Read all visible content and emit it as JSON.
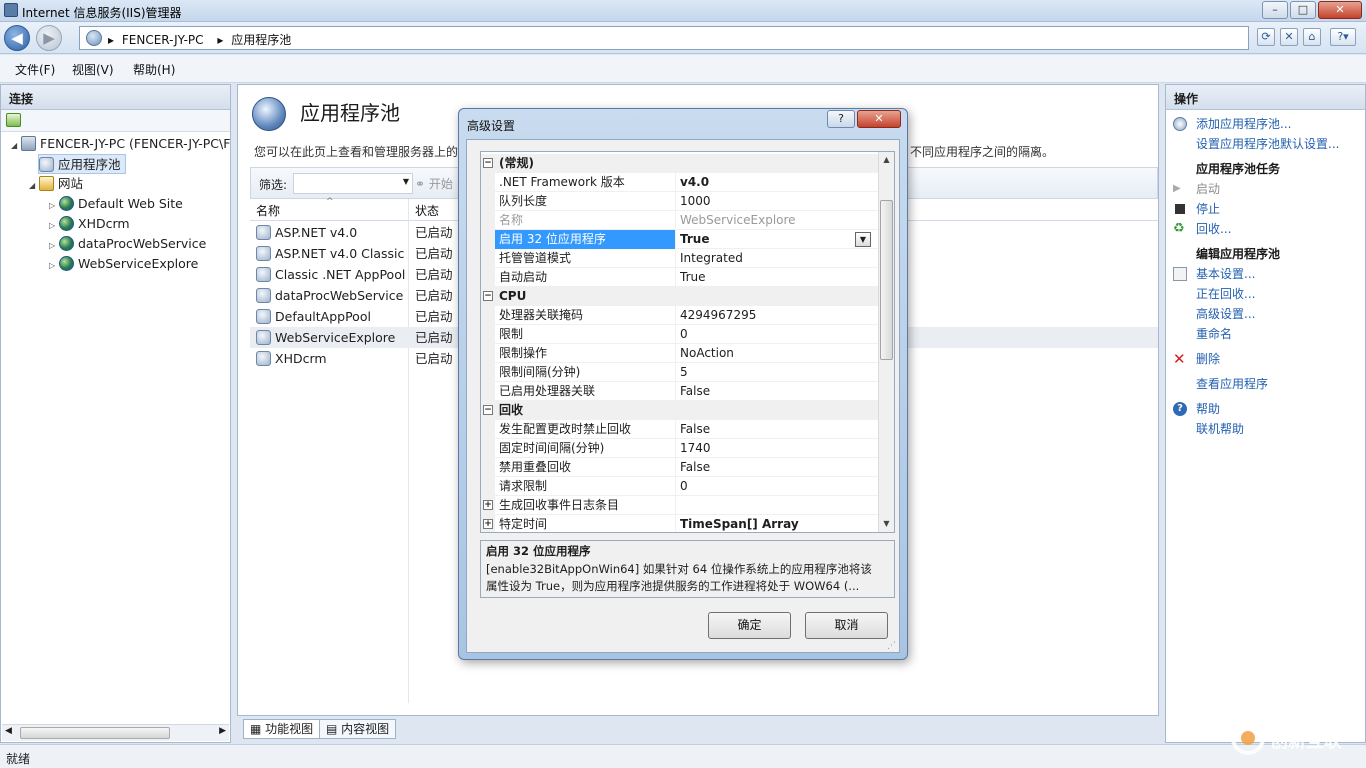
{
  "window": {
    "title": "Internet 信息服务(IIS)管理器",
    "controls": [
      "–",
      "□",
      "✕"
    ]
  },
  "address": {
    "server": "FENCER-JY-PC",
    "page": "应用程序池",
    "separator": "▸"
  },
  "menu": {
    "file": "文件(F)",
    "view": "视图(V)",
    "help": "帮助(H)"
  },
  "connections": {
    "header": "连接",
    "tree": [
      {
        "label": "FENCER-JY-PC (FENCER-JY-PC\\F"
      },
      {
        "label": "应用程序池"
      },
      {
        "label": "网站"
      },
      {
        "label": "Default Web Site"
      },
      {
        "label": "XHDcrm"
      },
      {
        "label": "dataProcWebService"
      },
      {
        "label": "WebServiceExplore"
      }
    ]
  },
  "center": {
    "heading": "应用程序池",
    "description": "您可以在此页上查看和管理服务器上的",
    "description_tail": "不同应用程序之间的隔离。",
    "filter_label": "筛选:",
    "start_button": "开始",
    "columns": {
      "name": "名称",
      "status": "状态"
    },
    "rows": [
      {
        "name": "ASP.NET v4.0",
        "status": "已启动"
      },
      {
        "name": "ASP.NET v4.0 Classic",
        "status": "已启动"
      },
      {
        "name": "Classic .NET AppPool",
        "status": "已启动"
      },
      {
        "name": "dataProcWebService",
        "status": "已启动"
      },
      {
        "name": "DefaultAppPool",
        "status": "已启动"
      },
      {
        "name": "WebServiceExplore",
        "status": "已启动"
      },
      {
        "name": "XHDcrm",
        "status": "已启动"
      }
    ],
    "tabs": {
      "features": "功能视图",
      "content": "内容视图"
    }
  },
  "actions": {
    "header": "操作",
    "add_pool": "添加应用程序池...",
    "set_defaults": "设置应用程序池默认设置...",
    "tasks_heading": "应用程序池任务",
    "start": "启动",
    "stop": "停止",
    "recycle": "回收...",
    "edit_heading": "编辑应用程序池",
    "basic_settings": "基本设置...",
    "recycling": "正在回收...",
    "advanced_settings": "高级设置...",
    "rename": "重命名",
    "delete": "删除",
    "view_apps": "查看应用程序",
    "help": "帮助",
    "online_help": "联机帮助"
  },
  "status": {
    "text": "就绪"
  },
  "dialog": {
    "title": "高级设置",
    "help_btn": "?",
    "close_btn": "✕",
    "groups": [
      {
        "label": "(常规)",
        "rows": [
          {
            "key": ".NET Framework 版本",
            "value": "v4.0"
          },
          {
            "key": "队列长度",
            "value": "1000"
          },
          {
            "key": "名称",
            "value": "WebServiceExplore"
          },
          {
            "key": "启用 32 位应用程序",
            "value": "True"
          },
          {
            "key": "托管管道模式",
            "value": "Integrated"
          },
          {
            "key": "自动启动",
            "value": "True"
          }
        ]
      },
      {
        "label": "CPU",
        "rows": [
          {
            "key": "处理器关联掩码",
            "value": "4294967295"
          },
          {
            "key": "限制",
            "value": "0"
          },
          {
            "key": "限制操作",
            "value": "NoAction"
          },
          {
            "key": "限制间隔(分钟)",
            "value": "5"
          },
          {
            "key": "已启用处理器关联",
            "value": "False"
          }
        ]
      },
      {
        "label": "回收",
        "rows": [
          {
            "key": "发生配置更改时禁止回收",
            "value": "False"
          },
          {
            "key": "固定时间间隔(分钟)",
            "value": "1740"
          },
          {
            "key": "禁用重叠回收",
            "value": "False"
          },
          {
            "key": "请求限制",
            "value": "0"
          },
          {
            "key": "生成回收事件日志条目",
            "value": ""
          },
          {
            "key": "特定时间",
            "value": "TimeSpan[] Array"
          }
        ]
      }
    ],
    "desc_title": "启用 32 位应用程序",
    "desc_line1": "[enable32BitAppOnWin64] 如果针对 64 位操作系统上的应用程序池将该",
    "desc_line2": "属性设为 True，则为应用程序池提供服务的工作进程将处于 WOW64 (...",
    "ok": "确定",
    "cancel": "取消"
  },
  "watermark": {
    "text": "创新互联"
  }
}
